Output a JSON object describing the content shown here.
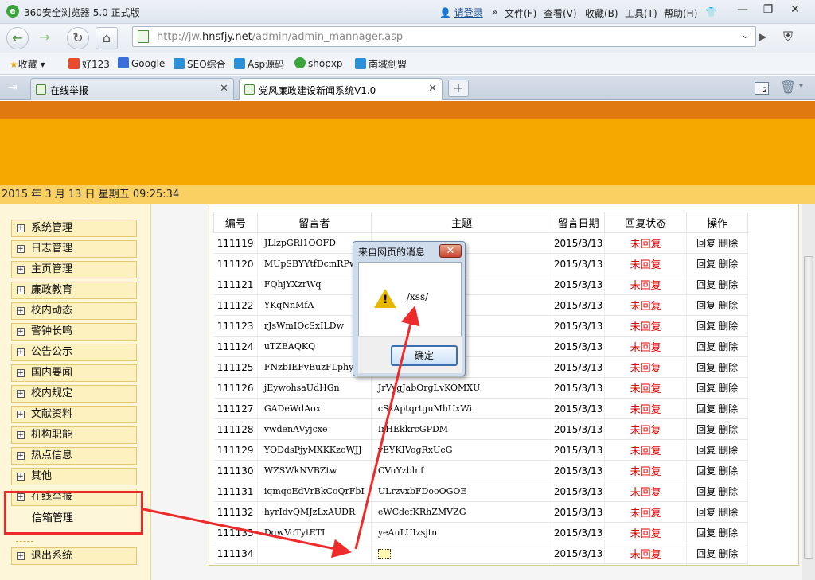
{
  "browser": {
    "title": "360安全浏览器 5.0 正式版",
    "login": "请登录",
    "menu": [
      "文件(F)",
      "查看(V)",
      "收藏(B)",
      "工具(T)",
      "帮助(H)"
    ],
    "address_prefix": "http://jw.",
    "address_domain": "hnsfjy.net",
    "address_path": "/admin/admin_mannager.asp",
    "bookmarks_label": "收藏",
    "bookmarks": [
      "好123",
      "Google",
      "SEO综合",
      "Asp源码",
      "shopxp",
      "南域剑盟"
    ],
    "tabs": [
      {
        "label": "在线举报",
        "active": false
      },
      {
        "label": "党风廉政建设新闻系统V1.0",
        "active": true
      }
    ],
    "tab_count": "2"
  },
  "page": {
    "date": "2015 年 3 月 13 日 星期五 09:25:34",
    "sidebar": [
      "系统管理",
      "日志管理",
      "主页管理",
      "廉政教育",
      "校内动态",
      "警钟长鸣",
      "公告公示",
      "国内要闻",
      "校内规定",
      "文献资料",
      "机构职能",
      "热点信息",
      "其他",
      "在线举报"
    ],
    "sidebar_sub": "信箱管理",
    "sidebar_exit": "退出系统",
    "table": {
      "headers": [
        "编号",
        "留言者",
        "主题",
        "留言日期",
        "回复状态",
        "操作"
      ],
      "rows": [
        {
          "id": "111119",
          "author": "JLlzpGRl1OOFD",
          "subject": "",
          "date": "2015/3/13",
          "status": "未回复"
        },
        {
          "id": "111120",
          "author": "MUpSBYYtfDcmRPwB",
          "subject": "",
          "date": "2015/3/13",
          "status": "未回复"
        },
        {
          "id": "111121",
          "author": "FQhjYXzrWq",
          "subject": "",
          "date": "2015/3/13",
          "status": "未回复"
        },
        {
          "id": "111122",
          "author": "YKqNnMfA",
          "subject": "",
          "date": "2015/3/13",
          "status": "未回复"
        },
        {
          "id": "111123",
          "author": "rJsWmIOcSxILDw",
          "subject": "",
          "date": "2015/3/13",
          "status": "未回复"
        },
        {
          "id": "111124",
          "author": "uTZEAQKQ",
          "subject": "",
          "date": "2015/3/13",
          "status": "未回复"
        },
        {
          "id": "111125",
          "author": "FNzbIEFvEuzFLphygoX",
          "subject": "",
          "date": "2015/3/13",
          "status": "未回复"
        },
        {
          "id": "111126",
          "author": "jEywohsaUdHGn",
          "subject": "JrVygJabOrgLvKOMXU",
          "date": "2015/3/13",
          "status": "未回复"
        },
        {
          "id": "111127",
          "author": "GADeWdAox",
          "subject": "cSzAptqrtguMhUxWi",
          "date": "2015/3/13",
          "status": "未回复"
        },
        {
          "id": "111128",
          "author": "vwdenAVyjcxe",
          "subject": "IrHEkkrcGPDM",
          "date": "2015/3/13",
          "status": "未回复"
        },
        {
          "id": "111129",
          "author": "YODdsPjyMXKKzoWJJ",
          "subject": "vEYKIVogRxUeG",
          "date": "2015/3/13",
          "status": "未回复"
        },
        {
          "id": "111130",
          "author": "WZSWkNVBZtw",
          "subject": "CVuYzblnf",
          "date": "2015/3/13",
          "status": "未回复"
        },
        {
          "id": "111131",
          "author": "iqmqoEdVrBkCoQrFbI",
          "subject": "ULrzvxbFDooOGOE",
          "date": "2015/3/13",
          "status": "未回复"
        },
        {
          "id": "111132",
          "author": "hyrIdvQMJzLxAUDR",
          "subject": "eWCdefKRhZMVZG",
          "date": "2015/3/13",
          "status": "未回复"
        },
        {
          "id": "111133",
          "author": "DqwVoTytETI",
          "subject": "yeAuLUIzsjtn",
          "date": "2015/3/13",
          "status": "未回复"
        },
        {
          "id": "111134",
          "author": "",
          "subject": "",
          "date": "2015/3/13",
          "status": "未回复"
        }
      ],
      "reply_label": "回复",
      "delete_label": "删除"
    },
    "dialog": {
      "title": "来自网页的消息",
      "message": "/xss/",
      "ok": "确定"
    }
  },
  "colors": {
    "banner": "#f7a800",
    "banner_top": "#e07a10",
    "status_red": "#dd0000",
    "annotation_red": "#ee2b2b"
  }
}
